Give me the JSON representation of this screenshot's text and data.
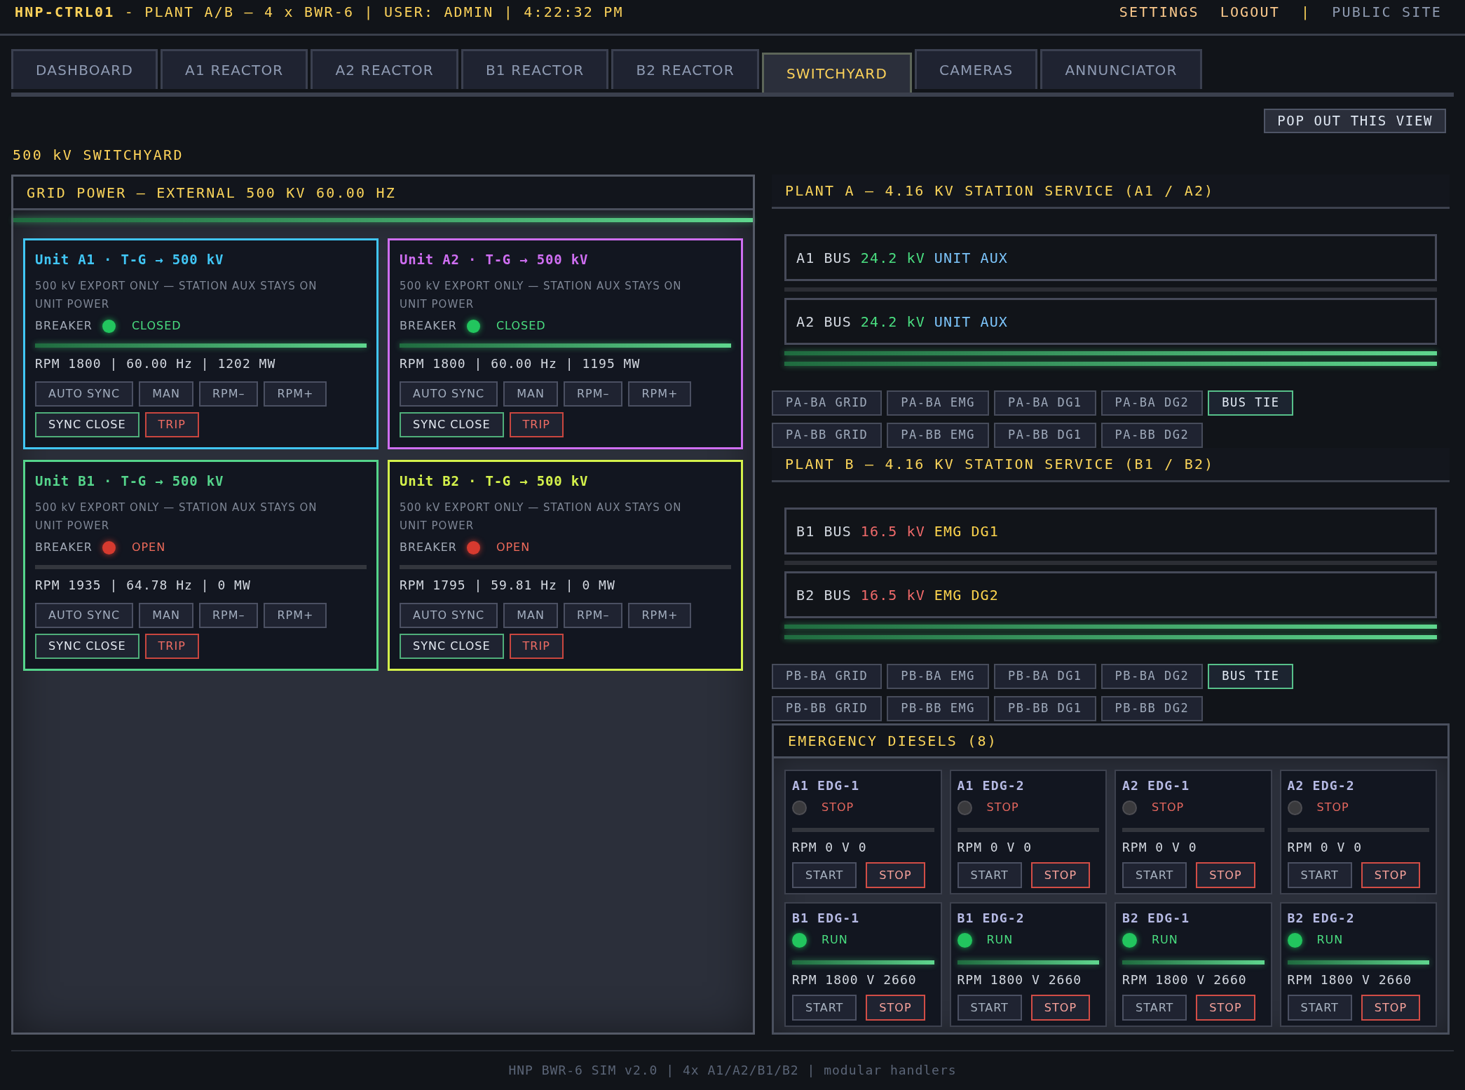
{
  "header": {
    "title": "**HNP-CTRL01** - PLANT A/B — 4 x BWR-6 | USER: ADMIN | 4:22:32 PM",
    "links": [
      {
        "label": "SETTINGS",
        "kind": "action"
      },
      {
        "label": "LOGOUT",
        "kind": "action"
      },
      {
        "label": "|",
        "kind": "separator"
      },
      {
        "label": "PUBLIC SITE",
        "kind": "external"
      }
    ]
  },
  "tabs": [
    {
      "label": "DASHBOARD",
      "selected": false
    },
    {
      "label": "A1 REACTOR",
      "selected": false
    },
    {
      "label": "A2 REACTOR",
      "selected": false
    },
    {
      "label": "B1 REACTOR",
      "selected": false
    },
    {
      "label": "B2 REACTOR",
      "selected": false
    },
    {
      "label": "SWITCHYARD",
      "selected": true
    },
    {
      "label": "CAMERAS",
      "selected": false
    },
    {
      "label": "ANNUNCIATOR",
      "selected": false
    }
  ],
  "toolbar": {
    "pop_out_button": "POP OUT THIS VIEW"
  },
  "page_title": "500 kV SWITCHYARD",
  "grid_panel": {
    "title": "GRID POWER — EXTERNAL 500 KV 60.00 HZ",
    "units": [
      {
        "title": "Unit A1 · T-G → 500 kV",
        "color": "#41c6f5",
        "note": "500 kV EXPORT ONLY — STATION AUX STAYS ON UNIT POWER",
        "breaker_label": "BREAKER",
        "breaker_closed": true,
        "breaker_state": "CLOSED",
        "readout": "RPM 1800 | 60.00 Hz | 1202 MW",
        "button_rows": [
          [
            {
              "label": "AUTO SYNC",
              "kind": "auto_sync"
            },
            {
              "label": "MAN",
              "kind": "manual"
            },
            {
              "label": "RPM–",
              "kind": "rpm_down"
            },
            {
              "label": "RPM+",
              "kind": "rpm_up"
            }
          ],
          [
            {
              "label": "SYNC CLOSE",
              "kind": "sync_close"
            },
            {
              "label": "TRIP",
              "kind": "trip"
            }
          ]
        ]
      },
      {
        "title": "Unit A2 · T-G → 500 kV",
        "color": "#cf6ef2",
        "note": "500 kV EXPORT ONLY — STATION AUX STAYS ON UNIT POWER",
        "breaker_label": "BREAKER",
        "breaker_closed": true,
        "breaker_state": "CLOSED",
        "readout": "RPM 1800 | 60.00 Hz | 1195 MW",
        "button_rows": [
          [
            {
              "label": "AUTO SYNC",
              "kind": "auto_sync"
            },
            {
              "label": "MAN",
              "kind": "manual"
            },
            {
              "label": "RPM–",
              "kind": "rpm_down"
            },
            {
              "label": "RPM+",
              "kind": "rpm_up"
            }
          ],
          [
            {
              "label": "SYNC CLOSE",
              "kind": "sync_close"
            },
            {
              "label": "TRIP",
              "kind": "trip"
            }
          ]
        ]
      },
      {
        "title": "Unit B1 · T-G → 500 kV",
        "color": "#55d48b",
        "note": "500 kV EXPORT ONLY — STATION AUX STAYS ON UNIT POWER",
        "breaker_label": "BREAKER",
        "breaker_closed": false,
        "breaker_state": "OPEN",
        "readout": "RPM 1935 | 64.78 Hz | 0 MW",
        "button_rows": [
          [
            {
              "label": "AUTO SYNC",
              "kind": "auto_sync"
            },
            {
              "label": "MAN",
              "kind": "manual"
            },
            {
              "label": "RPM–",
              "kind": "rpm_down"
            },
            {
              "label": "RPM+",
              "kind": "rpm_up"
            }
          ],
          [
            {
              "label": "SYNC CLOSE",
              "kind": "sync_close"
            },
            {
              "label": "TRIP",
              "kind": "trip"
            }
          ]
        ]
      },
      {
        "title": "Unit B2 · T-G → 500 kV",
        "color": "#d4f14b",
        "note": "500 kV EXPORT ONLY — STATION AUX STAYS ON UNIT POWER",
        "breaker_label": "BREAKER",
        "breaker_closed": false,
        "breaker_state": "OPEN",
        "readout": "RPM 1795 | 59.81 Hz | 0 MW",
        "button_rows": [
          [
            {
              "label": "AUTO SYNC",
              "kind": "auto_sync"
            },
            {
              "label": "MAN",
              "kind": "manual"
            },
            {
              "label": "RPM–",
              "kind": "rpm_down"
            },
            {
              "label": "RPM+",
              "kind": "rpm_up"
            }
          ],
          [
            {
              "label": "SYNC CLOSE",
              "kind": "sync_close"
            },
            {
              "label": "TRIP",
              "kind": "trip"
            }
          ]
        ]
      }
    ]
  },
  "plants": [
    {
      "title": "PLANT A — 4.16 KV STATION SERVICE (A1 / A2)",
      "buses": [
        {
          "name": "A1 BUS",
          "voltage": "24.2 kV",
          "source": "UNIT AUX",
          "kind": "unit_aux"
        },
        {
          "name": "A2 BUS",
          "voltage": "24.2 kV",
          "source": "UNIT AUX",
          "kind": "unit_aux"
        }
      ],
      "switch_rows": [
        [
          {
            "label": "PA-BA GRID",
            "on": false
          },
          {
            "label": "PA-BA EMG",
            "on": false
          },
          {
            "label": "PA-BA DG1",
            "on": false
          },
          {
            "label": "PA-BA DG2",
            "on": false
          },
          {
            "label": "BUS TIE",
            "on": true
          }
        ],
        [
          {
            "label": "PA-BB GRID",
            "on": false
          },
          {
            "label": "PA-BB EMG",
            "on": false
          },
          {
            "label": "PA-BB DG1",
            "on": false
          },
          {
            "label": "PA-BB DG2",
            "on": false
          }
        ]
      ]
    },
    {
      "title": "PLANT B — 4.16 KV STATION SERVICE (B1 / B2)",
      "buses": [
        {
          "name": "B1 BUS",
          "voltage": "16.5 kV",
          "source": "EMG DG1",
          "kind": "emergency"
        },
        {
          "name": "B2 BUS",
          "voltage": "16.5 kV",
          "source": "EMG DG2",
          "kind": "emergency"
        }
      ],
      "switch_rows": [
        [
          {
            "label": "PB-BA GRID",
            "on": false
          },
          {
            "label": "PB-BA EMG",
            "on": false
          },
          {
            "label": "PB-BA DG1",
            "on": false
          },
          {
            "label": "PB-BA DG2",
            "on": false
          },
          {
            "label": "BUS TIE",
            "on": true
          }
        ],
        [
          {
            "label": "PB-BB GRID",
            "on": false
          },
          {
            "label": "PB-BB EMG",
            "on": false
          },
          {
            "label": "PB-BB DG1",
            "on": false
          },
          {
            "label": "PB-BB DG2",
            "on": false
          }
        ]
      ]
    }
  ],
  "emergency_diesels": {
    "title": "EMERGENCY DIESELS (8)",
    "units": [
      {
        "name": "A1 EDG-1",
        "running": false,
        "status": "STOP",
        "readout": "RPM 0 V 0",
        "buttons": [
          {
            "label": "START",
            "kind": "start"
          },
          {
            "label": "STOP",
            "kind": "stop"
          }
        ]
      },
      {
        "name": "A1 EDG-2",
        "running": false,
        "status": "STOP",
        "readout": "RPM 0 V 0",
        "buttons": [
          {
            "label": "START",
            "kind": "start"
          },
          {
            "label": "STOP",
            "kind": "stop"
          }
        ]
      },
      {
        "name": "A2 EDG-1",
        "running": false,
        "status": "STOP",
        "readout": "RPM 0 V 0",
        "buttons": [
          {
            "label": "START",
            "kind": "start"
          },
          {
            "label": "STOP",
            "kind": "stop"
          }
        ]
      },
      {
        "name": "A2 EDG-2",
        "running": false,
        "status": "STOP",
        "readout": "RPM 0 V 0",
        "buttons": [
          {
            "label": "START",
            "kind": "start"
          },
          {
            "label": "STOP",
            "kind": "stop"
          }
        ]
      },
      {
        "name": "B1 EDG-1",
        "running": true,
        "status": "RUN",
        "readout": "RPM 1800 V 2660",
        "buttons": [
          {
            "label": "START",
            "kind": "start"
          },
          {
            "label": "STOP",
            "kind": "stop"
          }
        ]
      },
      {
        "name": "B1 EDG-2",
        "running": true,
        "status": "RUN",
        "readout": "RPM 1800 V 2660",
        "buttons": [
          {
            "label": "START",
            "kind": "start"
          },
          {
            "label": "STOP",
            "kind": "stop"
          }
        ]
      },
      {
        "name": "B2 EDG-1",
        "running": true,
        "status": "RUN",
        "readout": "RPM 1800 V 2660",
        "buttons": [
          {
            "label": "START",
            "kind": "start"
          },
          {
            "label": "STOP",
            "kind": "stop"
          }
        ]
      },
      {
        "name": "B2 EDG-2",
        "running": true,
        "status": "RUN",
        "readout": "RPM 1800 V 2660",
        "buttons": [
          {
            "label": "START",
            "kind": "start"
          },
          {
            "label": "STOP",
            "kind": "stop"
          }
        ]
      }
    ]
  },
  "footer": "HNP BWR-6 SIM v2.0 | 4x A1/A2/B1/B2 | modular handlers"
}
